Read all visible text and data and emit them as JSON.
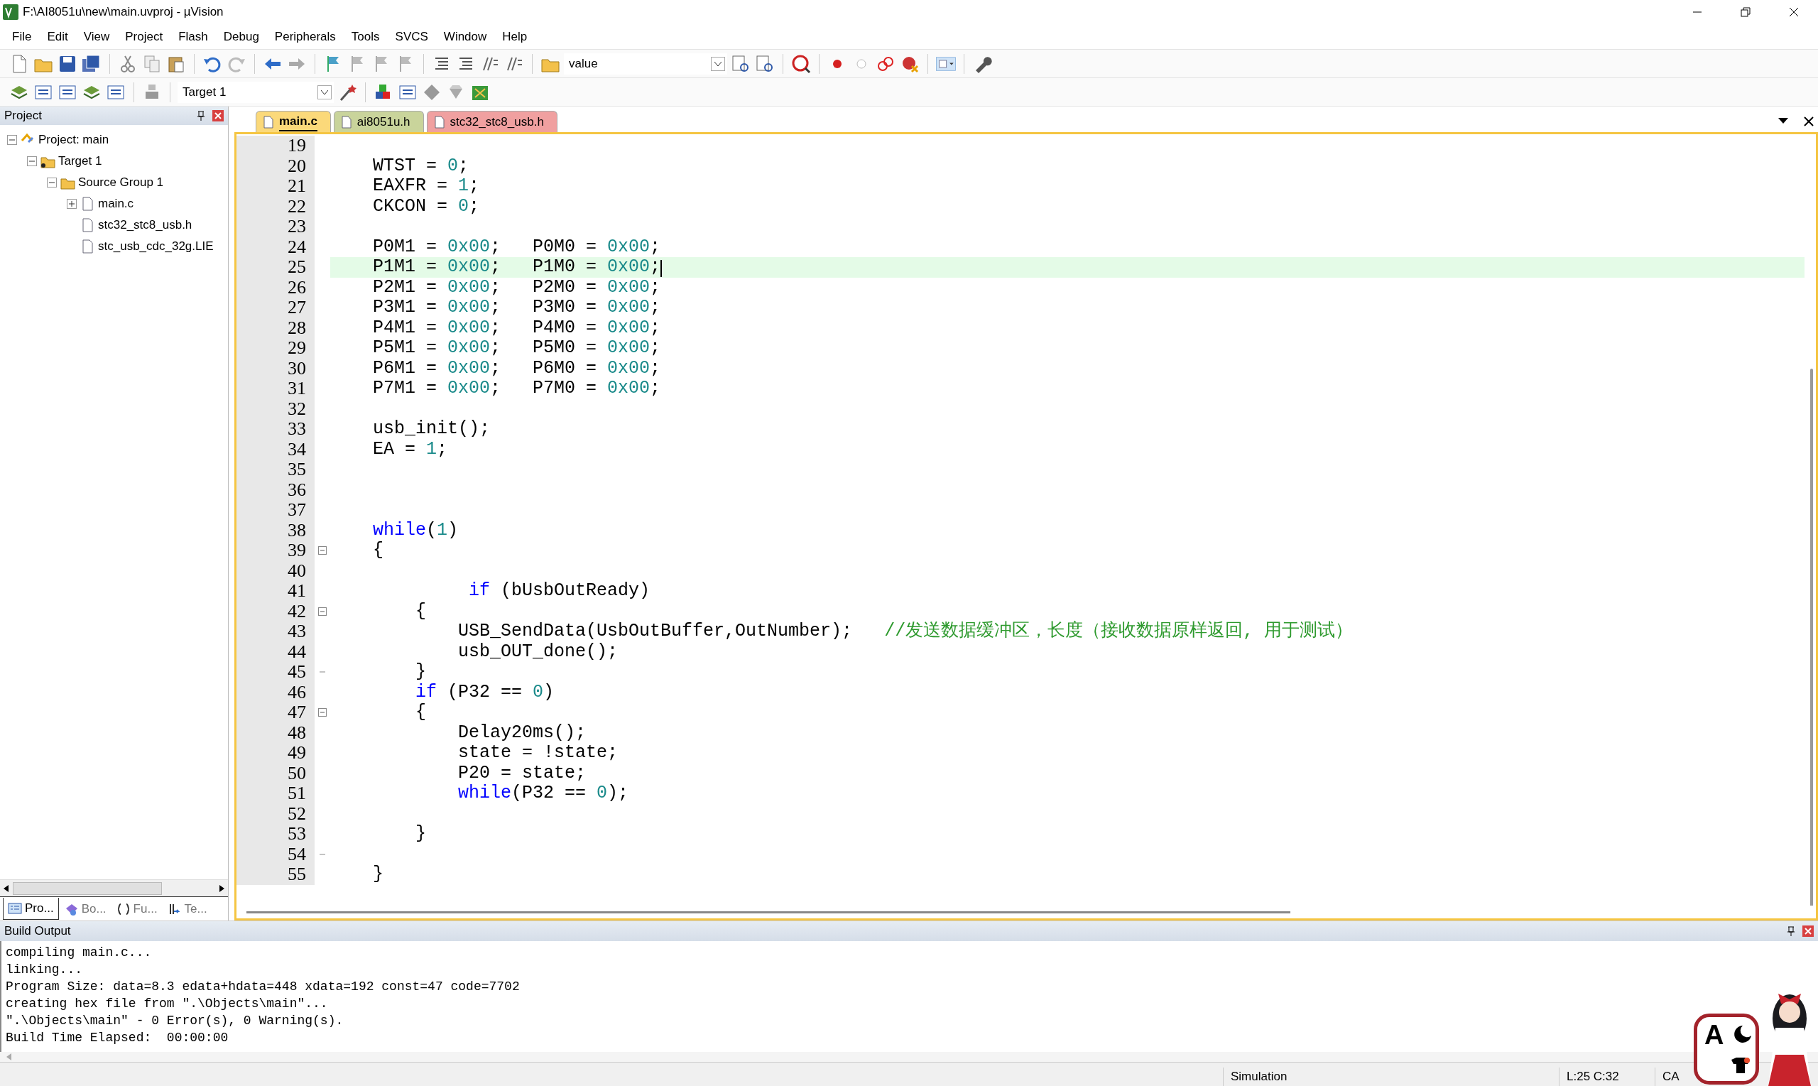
{
  "window": {
    "title": "F:\\AI8051u\\new\\main.uvproj - µVision"
  },
  "menu": [
    "File",
    "Edit",
    "View",
    "Project",
    "Flash",
    "Debug",
    "Peripherals",
    "Tools",
    "SVCS",
    "Window",
    "Help"
  ],
  "toolbar": {
    "find_field": {
      "value": "value"
    },
    "target_field": {
      "value": "Target 1"
    }
  },
  "project_panel": {
    "title": "Project",
    "tree": [
      {
        "label": "Project: main",
        "kind": "project",
        "expanded": true,
        "children": [
          {
            "label": "Target 1",
            "kind": "target",
            "expanded": true,
            "children": [
              {
                "label": "Source Group 1",
                "kind": "group",
                "expanded": true,
                "children": [
                  {
                    "label": "main.c",
                    "kind": "file",
                    "expanded": false
                  },
                  {
                    "label": "stc32_stc8_usb.h",
                    "kind": "file"
                  },
                  {
                    "label": "stc_usb_cdc_32g.LIE",
                    "kind": "file"
                  }
                ]
              }
            ]
          }
        ]
      }
    ],
    "tabs": [
      {
        "label": "Pro...",
        "kind": "project",
        "selected": true
      },
      {
        "label": "Bo...",
        "kind": "books",
        "selected": false
      },
      {
        "label": "Fu...",
        "kind": "functions",
        "selected": false
      },
      {
        "label": "Te...",
        "kind": "templates",
        "selected": false
      }
    ]
  },
  "editor": {
    "tabs": [
      {
        "label": "main.c",
        "selected": true,
        "color": "#fbd97a"
      },
      {
        "label": "ai8051u.h",
        "selected": false,
        "color": "#c9d49b"
      },
      {
        "label": "stc32_stc8_usb.h",
        "selected": false,
        "color": "#f0a0a0"
      }
    ],
    "lines": [
      {
        "number": "19",
        "kind": "line",
        "current": false
      },
      {
        "number": "20",
        "kind": "line",
        "current": false,
        "code": [
          {
            "kind": "plain",
            "text": "    WTST = "
          },
          {
            "kind": "number",
            "text": "0"
          },
          {
            "kind": "plain",
            "text": ";"
          }
        ]
      },
      {
        "number": "21",
        "kind": "line",
        "current": false,
        "code": [
          {
            "kind": "plain",
            "text": "    EAXFR = "
          },
          {
            "kind": "number",
            "text": "1"
          },
          {
            "kind": "plain",
            "text": ";"
          }
        ]
      },
      {
        "number": "22",
        "kind": "line",
        "current": false,
        "code": [
          {
            "kind": "plain",
            "text": "    CKCON = "
          },
          {
            "kind": "number",
            "text": "0"
          },
          {
            "kind": "plain",
            "text": ";"
          }
        ]
      },
      {
        "number": "23",
        "kind": "line",
        "current": false
      },
      {
        "number": "24",
        "kind": "line",
        "current": false,
        "code": [
          {
            "kind": "plain",
            "text": "    P0M1 = "
          },
          {
            "kind": "number",
            "text": "0x00"
          },
          {
            "kind": "plain",
            "text": ";   P0M0 = "
          },
          {
            "kind": "number",
            "text": "0x00"
          },
          {
            "kind": "plain",
            "text": ";"
          }
        ]
      },
      {
        "number": "25",
        "kind": "line",
        "current": true,
        "code": [
          {
            "kind": "plain",
            "text": "    P1M1 = "
          },
          {
            "kind": "number",
            "text": "0x00"
          },
          {
            "kind": "plain",
            "text": ";   P1M0 = "
          },
          {
            "kind": "number",
            "text": "0x00"
          },
          {
            "kind": "plain",
            "text": ";"
          }
        ]
      },
      {
        "number": "26",
        "kind": "line",
        "current": false,
        "code": [
          {
            "kind": "plain",
            "text": "    P2M1 = "
          },
          {
            "kind": "number",
            "text": "0x00"
          },
          {
            "kind": "plain",
            "text": ";   P2M0 = "
          },
          {
            "kind": "number",
            "text": "0x00"
          },
          {
            "kind": "plain",
            "text": ";"
          }
        ]
      },
      {
        "number": "27",
        "kind": "line",
        "current": false,
        "code": [
          {
            "kind": "plain",
            "text": "    P3M1 = "
          },
          {
            "kind": "number",
            "text": "0x00"
          },
          {
            "kind": "plain",
            "text": ";   P3M0 = "
          },
          {
            "kind": "number",
            "text": "0x00"
          },
          {
            "kind": "plain",
            "text": ";"
          }
        ]
      },
      {
        "number": "28",
        "kind": "line",
        "current": false,
        "code": [
          {
            "kind": "plain",
            "text": "    P4M1 = "
          },
          {
            "kind": "number",
            "text": "0x00"
          },
          {
            "kind": "plain",
            "text": ";   P4M0 = "
          },
          {
            "kind": "number",
            "text": "0x00"
          },
          {
            "kind": "plain",
            "text": ";"
          }
        ]
      },
      {
        "number": "29",
        "kind": "line",
        "current": false,
        "code": [
          {
            "kind": "plain",
            "text": "    P5M1 = "
          },
          {
            "kind": "number",
            "text": "0x00"
          },
          {
            "kind": "plain",
            "text": ";   P5M0 = "
          },
          {
            "kind": "number",
            "text": "0x00"
          },
          {
            "kind": "plain",
            "text": ";"
          }
        ]
      },
      {
        "number": "30",
        "kind": "line",
        "current": false,
        "code": [
          {
            "kind": "plain",
            "text": "    P6M1 = "
          },
          {
            "kind": "number",
            "text": "0x00"
          },
          {
            "kind": "plain",
            "text": ";   P6M0 = "
          },
          {
            "kind": "number",
            "text": "0x00"
          },
          {
            "kind": "plain",
            "text": ";"
          }
        ]
      },
      {
        "number": "31",
        "kind": "line",
        "current": false,
        "code": [
          {
            "kind": "plain",
            "text": "    P7M1 = "
          },
          {
            "kind": "number",
            "text": "0x00"
          },
          {
            "kind": "plain",
            "text": ";   P7M0 = "
          },
          {
            "kind": "number",
            "text": "0x00"
          },
          {
            "kind": "plain",
            "text": ";"
          }
        ]
      },
      {
        "number": "32",
        "kind": "line",
        "current": false
      },
      {
        "number": "33",
        "kind": "line",
        "current": false,
        "code": [
          {
            "kind": "plain",
            "text": "    usb_init();"
          }
        ]
      },
      {
        "number": "34",
        "kind": "line",
        "current": false,
        "code": [
          {
            "kind": "plain",
            "text": "    EA = "
          },
          {
            "kind": "number",
            "text": "1"
          },
          {
            "kind": "plain",
            "text": ";"
          }
        ]
      },
      {
        "number": "35",
        "kind": "line",
        "current": false
      },
      {
        "number": "36",
        "kind": "line",
        "current": false
      },
      {
        "number": "37",
        "kind": "line",
        "current": false
      },
      {
        "number": "38",
        "kind": "line",
        "current": false,
        "code": [
          {
            "kind": "keyword",
            "text": "    while"
          },
          {
            "kind": "plain",
            "text": "("
          },
          {
            "kind": "number",
            "text": "1"
          },
          {
            "kind": "plain",
            "text": ")"
          }
        ]
      },
      {
        "number": "39",
        "kind": "fold_start",
        "current": false,
        "code": [
          {
            "kind": "plain",
            "text": "    {"
          }
        ]
      },
      {
        "number": "40",
        "kind": "line",
        "current": false
      },
      {
        "number": "41",
        "kind": "line",
        "current": false,
        "code": [
          {
            "kind": "keyword",
            "text": "             if"
          },
          {
            "kind": "plain",
            "text": " (bUsbOutReady)"
          }
        ]
      },
      {
        "number": "42",
        "kind": "fold_start",
        "current": false,
        "code": [
          {
            "kind": "plain",
            "text": "        {"
          }
        ]
      },
      {
        "number": "43",
        "kind": "line",
        "current": false,
        "code": [
          {
            "kind": "plain",
            "text": "            USB_SendData(UsbOutBuffer,OutNumber);   "
          },
          {
            "kind": "comment",
            "text": "//发送数据缓冲区，长度（接收数据原样返回, 用于测试）"
          }
        ]
      },
      {
        "number": "44",
        "kind": "line",
        "current": false,
        "code": [
          {
            "kind": "plain",
            "text": "            usb_OUT_done();"
          }
        ]
      },
      {
        "number": "45",
        "kind": "fold_end",
        "current": false,
        "code": [
          {
            "kind": "plain",
            "text": "        }"
          }
        ]
      },
      {
        "number": "46",
        "kind": "line",
        "current": false,
        "code": [
          {
            "kind": "keyword",
            "text": "        if"
          },
          {
            "kind": "plain",
            "text": " (P32 == "
          },
          {
            "kind": "number",
            "text": "0"
          },
          {
            "kind": "plain",
            "text": ")"
          }
        ]
      },
      {
        "number": "47",
        "kind": "fold_start",
        "current": false,
        "code": [
          {
            "kind": "plain",
            "text": "        {"
          }
        ]
      },
      {
        "number": "48",
        "kind": "line",
        "current": false,
        "code": [
          {
            "kind": "plain",
            "text": "            Delay20ms();"
          }
        ]
      },
      {
        "number": "49",
        "kind": "line",
        "current": false,
        "code": [
          {
            "kind": "plain",
            "text": "            state = !state;"
          }
        ]
      },
      {
        "number": "50",
        "kind": "line",
        "current": false,
        "code": [
          {
            "kind": "plain",
            "text": "            P20 = state;"
          }
        ]
      },
      {
        "number": "51",
        "kind": "line",
        "current": false,
        "code": [
          {
            "kind": "keyword",
            "text": "            while"
          },
          {
            "kind": "plain",
            "text": "(P32 == "
          },
          {
            "kind": "number",
            "text": "0"
          },
          {
            "kind": "plain",
            "text": ");"
          }
        ]
      },
      {
        "number": "52",
        "kind": "line",
        "current": false
      },
      {
        "number": "53",
        "kind": "line",
        "current": false,
        "code": [
          {
            "kind": "plain",
            "text": "        }"
          }
        ]
      },
      {
        "number": "54",
        "kind": "fold_end",
        "current": false
      },
      {
        "number": "55",
        "kind": "line",
        "current": false,
        "code": [
          {
            "kind": "plain",
            "text": "    }"
          }
        ]
      }
    ]
  },
  "build_output": {
    "title": "Build Output",
    "lines": [
      "compiling main.c...",
      "linking...",
      "Program Size: data=8.3 edata+hdata=448 xdata=192 const=47 code=7702",
      "creating hex file from \".\\Objects\\main\"...",
      "\".\\Objects\\main\" - 0 Error(s), 0 Warning(s).",
      "Build Time Elapsed:  00:00:00"
    ]
  },
  "status_bar": [
    "Simulation",
    "L:25 C:32",
    "CA"
  ],
  "ime_widget": {
    "mode": "A"
  }
}
